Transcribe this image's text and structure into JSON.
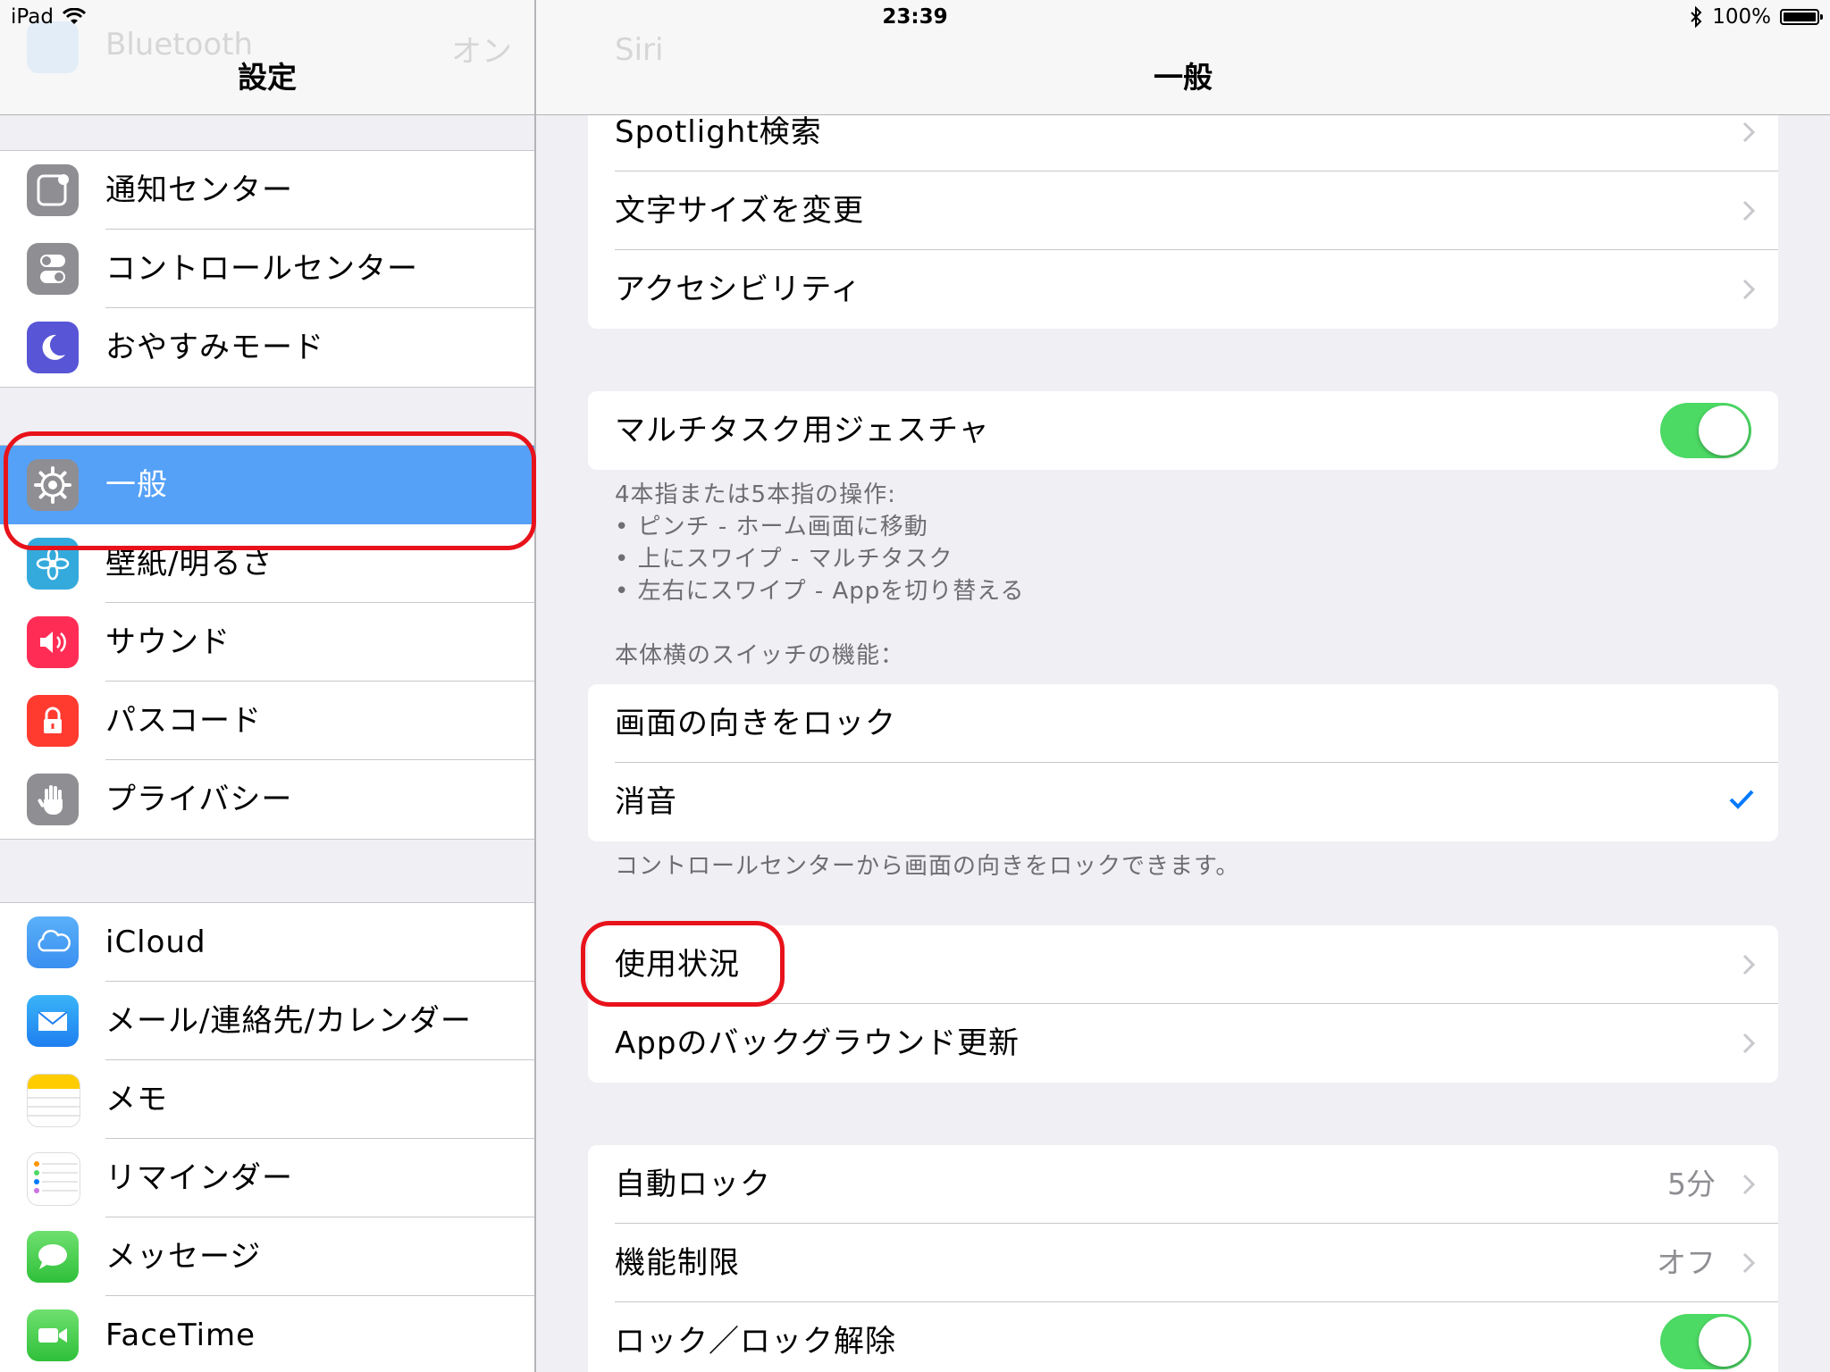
{
  "status_bar": {
    "device": "iPad",
    "time": "23:39",
    "battery": "100%"
  },
  "master": {
    "ghost_row": {
      "label": "Bluetooth",
      "value": "オン"
    },
    "title": "設定",
    "group1": [
      {
        "label": "通知センター",
        "icon": "notification-center-icon",
        "color": "#8e8e93"
      },
      {
        "label": "コントロールセンター",
        "icon": "control-center-icon",
        "color": "#8e8e93"
      },
      {
        "label": "おやすみモード",
        "icon": "moon-icon",
        "color": "#5856d6"
      }
    ],
    "group2": [
      {
        "label": "一般",
        "icon": "gear-icon",
        "color": "#8e8e93",
        "selected": true
      },
      {
        "label": "壁紙/明るさ",
        "icon": "wallpaper-icon",
        "color": "#34aadc"
      },
      {
        "label": "サウンド",
        "icon": "speaker-icon",
        "color": "#ff2d55"
      },
      {
        "label": "パスコード",
        "icon": "lock-icon",
        "color": "#ff3b30"
      },
      {
        "label": "プライバシー",
        "icon": "hand-icon",
        "color": "#8e8e93"
      }
    ],
    "group3": [
      {
        "label": "iCloud",
        "icon": "cloud-icon",
        "color": "#3a8ff0"
      },
      {
        "label": "メール/連絡先/カレンダー",
        "icon": "mail-icon",
        "color": "#1e8cf0"
      },
      {
        "label": "メモ",
        "icon": "notes-icon",
        "color": "#ffcc00"
      },
      {
        "label": "リマインダー",
        "icon": "reminders-icon",
        "color": "#ffffff"
      },
      {
        "label": "メッセージ",
        "icon": "messages-icon",
        "color": "#4cd964"
      },
      {
        "label": "FaceTime",
        "icon": "facetime-icon",
        "color": "#4cd964"
      }
    ]
  },
  "detail": {
    "ghost_row": {
      "label": "Siri"
    },
    "title": "一般",
    "card1": [
      {
        "label": "Spotlight検索"
      },
      {
        "label": "文字サイズを変更"
      },
      {
        "label": "アクセシビリティ"
      }
    ],
    "multitask": {
      "label": "マルチタスク用ジェスチャ",
      "on": true
    },
    "multitask_note": [
      "4本指または5本指の操作:",
      "• ピンチ - ホーム画面に移動",
      "• 上にスワイプ - マルチタスク",
      "• 左右にスワイプ - Appを切り替える"
    ],
    "switch_header": "本体横のスイッチの機能：",
    "switch_options": [
      {
        "label": "画面の向きをロック",
        "checked": false
      },
      {
        "label": "消音",
        "checked": true
      }
    ],
    "switch_footer": "コントロールセンターから画面の向きをロックできます。",
    "card4": [
      {
        "label": "使用状況"
      },
      {
        "label": "Appのバックグラウンド更新"
      }
    ],
    "card5": [
      {
        "label": "自動ロック",
        "value": "5分"
      },
      {
        "label": "機能制限",
        "value": "オフ"
      },
      {
        "label": "ロック／ロック解除",
        "toggle": true
      }
    ]
  },
  "annotations": {
    "highlight_color": "#e8121b",
    "accent": "#007aff"
  }
}
